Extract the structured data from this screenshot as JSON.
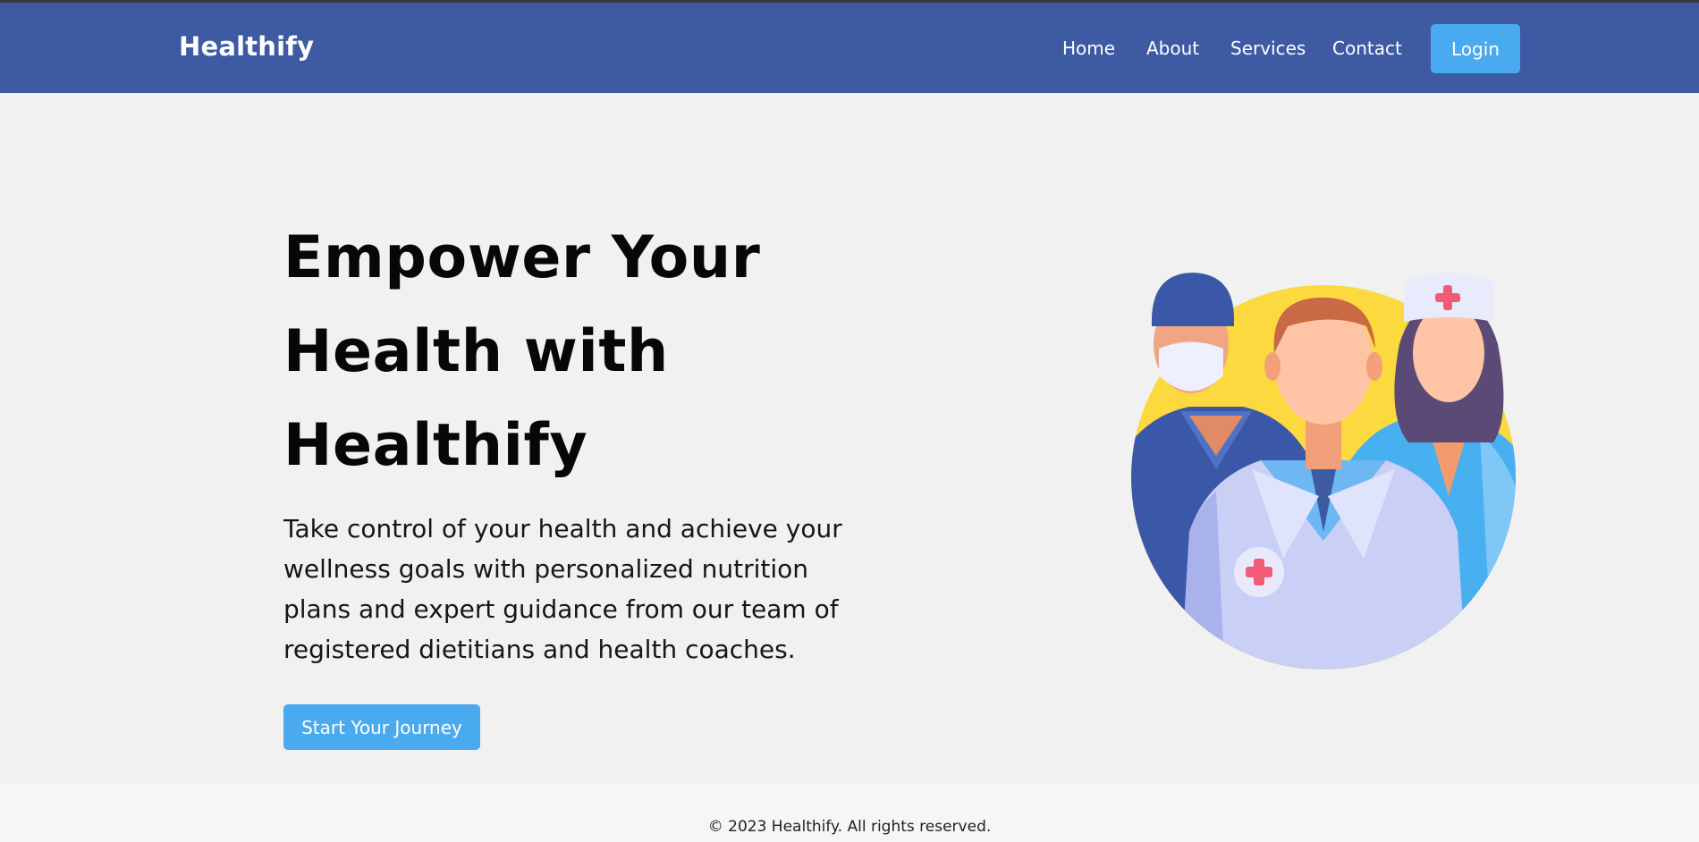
{
  "header": {
    "brand": "Healthify",
    "nav": [
      "Home",
      "About",
      "Services",
      "Contact"
    ],
    "login_label": "Login"
  },
  "hero": {
    "title_line1": "Empower Your",
    "title_line2": "Health with",
    "title_line3": "Healthify",
    "subtitle": "Take control of your health and achieve your wellness goals with personalized nutrition plans and expert guidance from our team of registered dietitians and health coaches.",
    "cta_label": "Start Your Journey"
  },
  "footer": {
    "copyright": "© 2023 Healthify. All rights reserved."
  },
  "colors": {
    "navbar": "#3d5aa3",
    "accent": "#4aaaf0",
    "background": "#f1f1f1"
  }
}
